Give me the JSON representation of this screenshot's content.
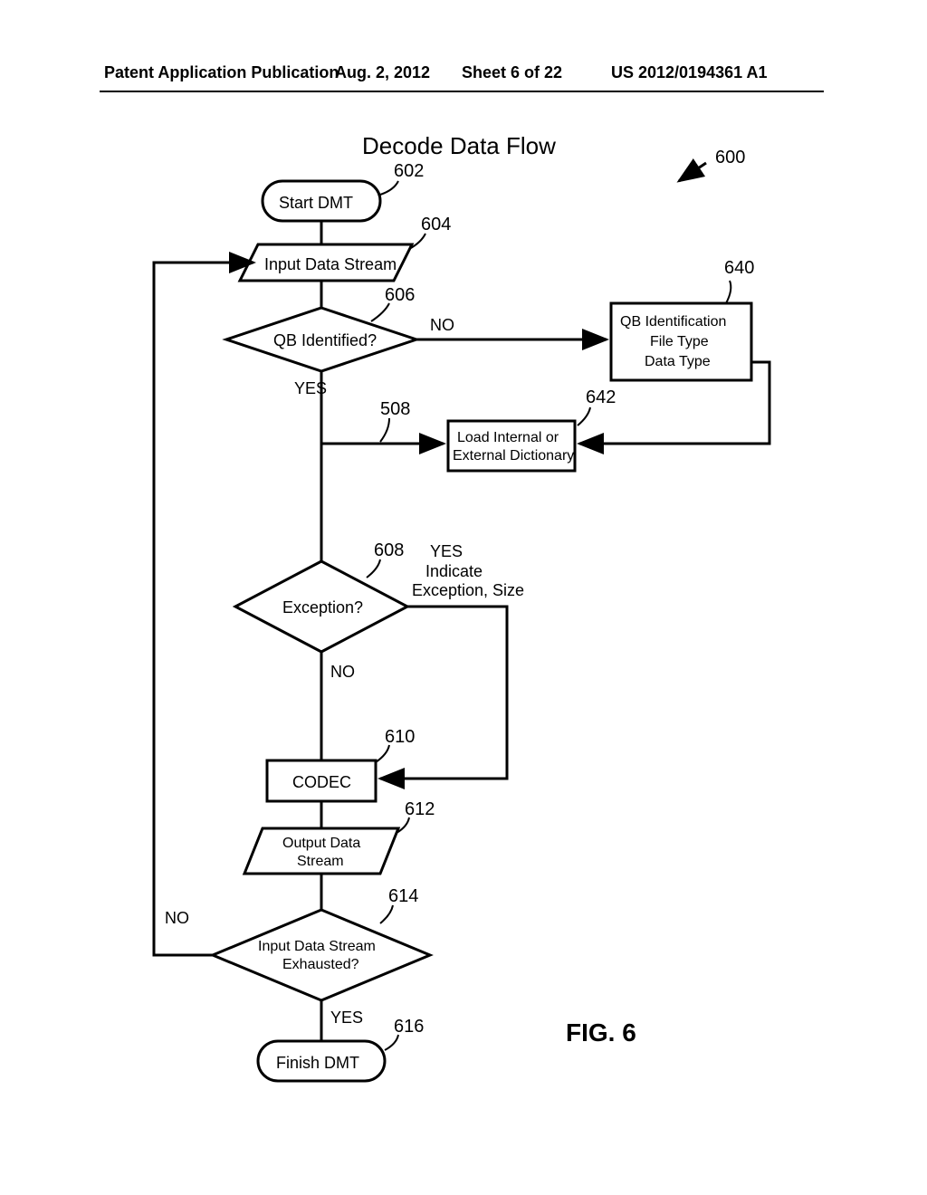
{
  "header": {
    "pubtype": "Patent Application Publication",
    "date": "Aug. 2, 2012",
    "sheet": "Sheet 6 of 22",
    "docnum": "US 2012/0194361 A1"
  },
  "title": "Decode Data Flow",
  "figure_label": "FIG. 6",
  "refs": {
    "r600": "600",
    "r602": "602",
    "r604": "604",
    "r606": "606",
    "r640": "640",
    "r508": "508",
    "r642": "642",
    "r608": "608",
    "r610": "610",
    "r612": "612",
    "r614": "614",
    "r616": "616"
  },
  "nodes": {
    "start": "Start DMT",
    "input": "Input Data Stream",
    "qb_identified": "QB Identified?",
    "qb_ident_box_l1": "QB Identification",
    "qb_ident_box_l2": "File Type",
    "qb_ident_box_l3": "Data Type",
    "load_dict_l1": "Load Internal or",
    "load_dict_l2": "External Dictionary",
    "exception": "Exception?",
    "exception_note_l1": "Indicate",
    "exception_note_l2": "Exception, Size",
    "codec": "CODEC",
    "output_l1": "Output Data",
    "output_l2": "Stream",
    "exhausted_l1": "Input Data Stream",
    "exhausted_l2": "Exhausted?",
    "finish": "Finish DMT"
  },
  "labels": {
    "yes": "YES",
    "no": "NO"
  }
}
